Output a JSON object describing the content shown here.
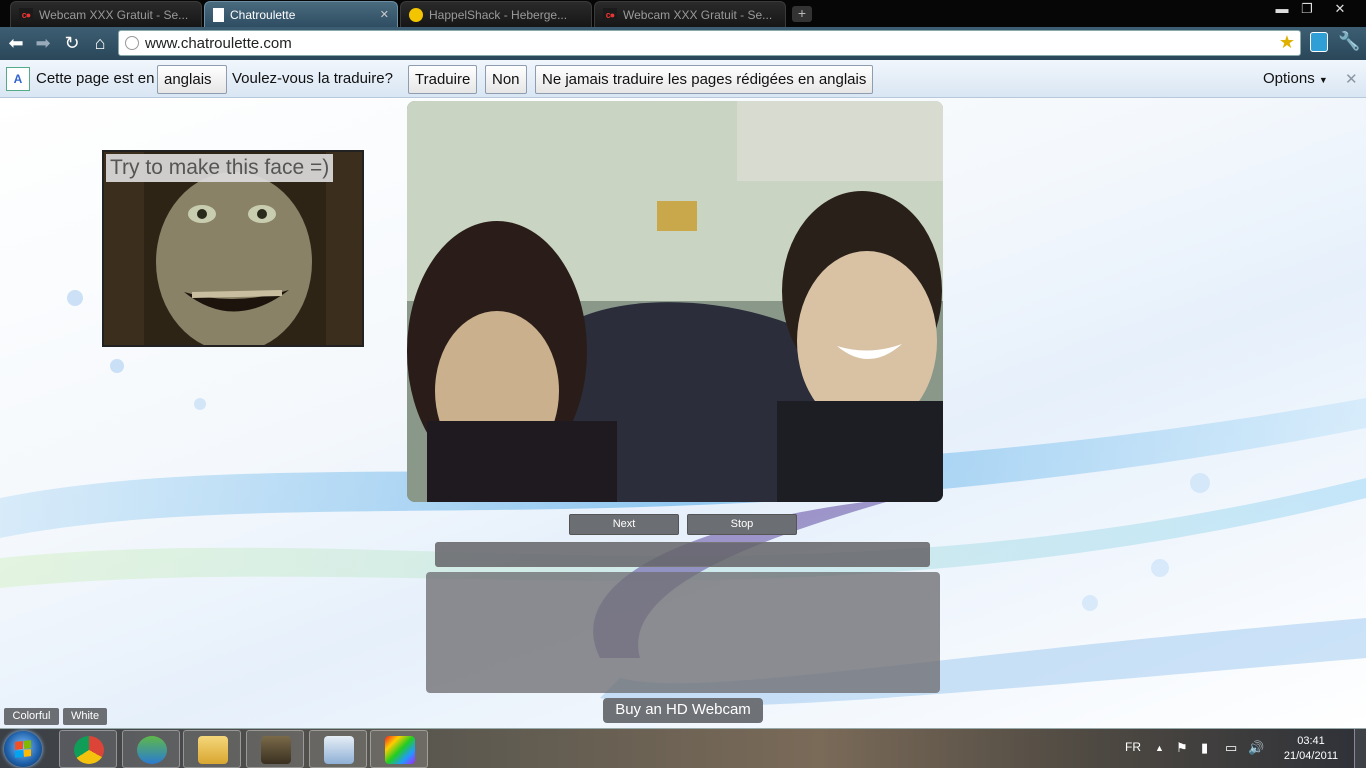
{
  "browser": {
    "tabs": [
      {
        "title": "Webcam XXX Gratuit - Se...",
        "favicon": "chatroulette-icon",
        "active": false
      },
      {
        "title": "Chatroulette",
        "favicon": "page-icon",
        "active": true
      },
      {
        "title": "HappelShack - Heberge...",
        "favicon": "happelshack-icon",
        "active": false
      },
      {
        "title": "Webcam XXX Gratuit - Se...",
        "favicon": "chatroulette-icon",
        "active": false
      }
    ],
    "tab_close_glyph": "✕",
    "new_tab_glyph": "+",
    "window_controls": {
      "minimize": "▬",
      "maximize": "❐",
      "close": "✕"
    },
    "url": "www.chatroulette.com"
  },
  "translate_bar": {
    "prefix": "Cette page est en",
    "language": "anglais",
    "question": "Voulez-vous la traduire?",
    "translate_button": "Traduire",
    "no_button": "Non",
    "never_button": "Ne jamais traduire les pages rédigées en anglais",
    "options": "Options",
    "close_glyph": "✕"
  },
  "page": {
    "face_caption": "Try to make this face =)",
    "next_button": "Next",
    "stop_button": "Stop",
    "message_input_value": "",
    "buy_webcam_button": "Buy an HD Webcam",
    "theme_colorful": "Colorful",
    "theme_white": "White"
  },
  "taskbar": {
    "apps": [
      "chrome-icon",
      "messenger-icon",
      "explorer-folder-icon",
      "game-icon",
      "picture-viewer-icon",
      "studio-icon"
    ],
    "language": "FR",
    "time": "03:41",
    "date": "21/04/2011"
  },
  "colors": {
    "tab_bar": "#060606",
    "toolbar": "#2a4759",
    "translate_bar": "#d9e6f3",
    "page_button": "#6b6e72"
  }
}
